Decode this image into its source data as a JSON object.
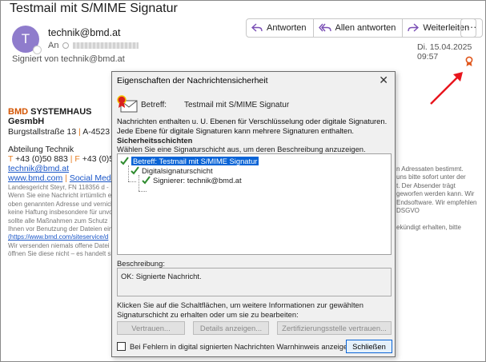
{
  "email": {
    "subject": "Testmail mit S/MIME Signatur",
    "avatar_letter": "T",
    "sender": "technik@bmd.at",
    "to_label": "An",
    "signed_by": "Signiert von technik@bmd.at",
    "date": "Di. 15.04.2025 09:57",
    "actions": {
      "reply": "Antworten",
      "reply_all": "Allen antworten",
      "forward": "Weiterleiten",
      "more": "···"
    }
  },
  "signature": {
    "company_brand": "BMD",
    "company_rest": " SYSTEMHAUS GesmbH",
    "address_a": "Burgstallstraße 13",
    "address_sep": " | ",
    "address_b": "A-4523 Neu",
    "dept": "Abteilung Technik",
    "phone_t": "T",
    "phone_t_num": " +43 (0)50 883",
    "phone_sep": " | ",
    "phone_f": "F",
    "phone_f_num": " +43 (0)50",
    "email": "technik@bmd.at",
    "web": "www.bmd.com",
    "web_sep": " | ",
    "social": "Social Media",
    "legal": [
      "Landesgericht Steyr, FN 118356 d -",
      "Wenn Sie eine Nachricht irrtümlich e",
      "oben genannten Adresse und vernich",
      "keine Haftung insbesondere für unvo",
      "sollte alle Maßnahmen zum Schutz",
      "Ihnen vor Benutzung der Dateien ein",
      "(https://www.bmd.com/siteservice/d",
      "Wir versenden niemals offene Datei",
      "öffnen Sie diese nicht – es handelt si"
    ],
    "legal_right": [
      "n Adressaten bestimmt.",
      "uns bitte sofort unter der",
      "t. Der Absender trägt",
      "geworfen werden kann. Wir",
      "Endsoftware. Wir empfehlen",
      "DSGVO",
      "",
      "ekündigt erhalten, bitte"
    ]
  },
  "dialog": {
    "title": "Eigenschaften der Nachrichtensicherheit",
    "close": "✕",
    "betreff_label": "Betreff:",
    "betreff_value": "Testmail mit S/MIME Signatur",
    "description": "Nachrichten enthalten u. U. Ebenen für Verschlüsselung oder digitale Signaturen. Jede Ebene für digitale Signaturen kann mehrere Signaturen enthalten.",
    "security_layers_heading": "Sicherheitsschichten",
    "security_layers_hint": "Wählen Sie eine Signaturschicht aus, um deren Beschreibung anzuzeigen.",
    "tree": {
      "root": "Betreff: Testmail mit S/MIME Signatur",
      "layer": "Digitalsignaturschicht",
      "signer": "Signierer: technik@bmd.at"
    },
    "beschreibung_label": "Beschreibung:",
    "beschreibung_text": "OK: Signierte Nachricht.",
    "buttons_hint": "Klicken Sie auf die Schaltflächen, um weitere Informationen zur gewählten Signaturschicht zu erhalten oder um sie zu bearbeiten:",
    "btn_trust": "Vertrauen...",
    "btn_details": "Details anzeigen...",
    "btn_ca_trust": "Zertifizierungsstelle vertrauen...",
    "warn_checkbox": "Bei Fehlern in digital signierten Nachrichten Warnhinweis anzeigen.",
    "btn_close": "Schließen"
  },
  "colors": {
    "accent": "#0a64d6",
    "avatar": "#8f7ccc",
    "arrow": "#e8141c",
    "check": "#2e8b2e"
  }
}
